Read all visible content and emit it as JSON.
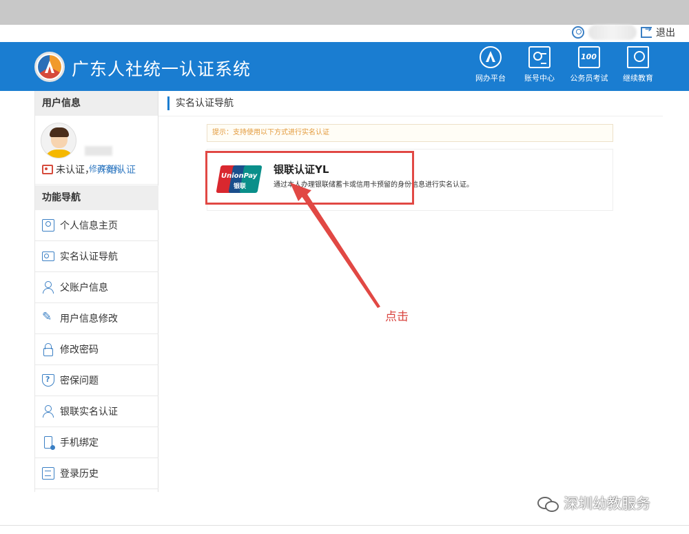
{
  "header": {
    "system_title": "广东人社统一认证系统",
    "logout_label": "退出",
    "nav": [
      {
        "label": "网办平台",
        "icon": "platform-icon"
      },
      {
        "label": "账号中心",
        "icon": "account-center-icon"
      },
      {
        "label": "公务员考试",
        "icon": "exam-icon"
      },
      {
        "label": "继续教育",
        "icon": "education-icon"
      }
    ]
  },
  "sidebar": {
    "user_info_title": "用户信息",
    "edit_profile": "修改资料",
    "verify_status": "未认证，",
    "start_verify": "开始认证",
    "nav_title": "功能导航",
    "items": [
      {
        "label": "个人信息主页",
        "icon": "profile-home-icon"
      },
      {
        "label": "实名认证导航",
        "icon": "id-card-icon"
      },
      {
        "label": "父账户信息",
        "icon": "user-icon"
      },
      {
        "label": "用户信息修改",
        "icon": "edit-icon"
      },
      {
        "label": "修改密码",
        "icon": "lock-icon"
      },
      {
        "label": "密保问题",
        "icon": "shield-icon"
      },
      {
        "label": "银联实名认证",
        "icon": "user-icon"
      },
      {
        "label": "手机绑定",
        "icon": "phone-icon"
      },
      {
        "label": "登录历史",
        "icon": "history-icon"
      }
    ]
  },
  "main": {
    "title": "实名认证导航",
    "tip": "提示：支持使用以下方式进行实名认证",
    "method": {
      "title": "银联认证YL",
      "description": "通过本人办理银联储蓄卡或信用卡预留的身份信息进行实名认证。",
      "logo_text": "UnionPay",
      "logo_cn": "银联"
    },
    "annotation": "点击"
  },
  "watermark": "深圳幼教服务",
  "colors": {
    "brand_blue": "#1a7dd1",
    "highlight_red": "#e14844",
    "tip_orange": "#e39a3c"
  }
}
